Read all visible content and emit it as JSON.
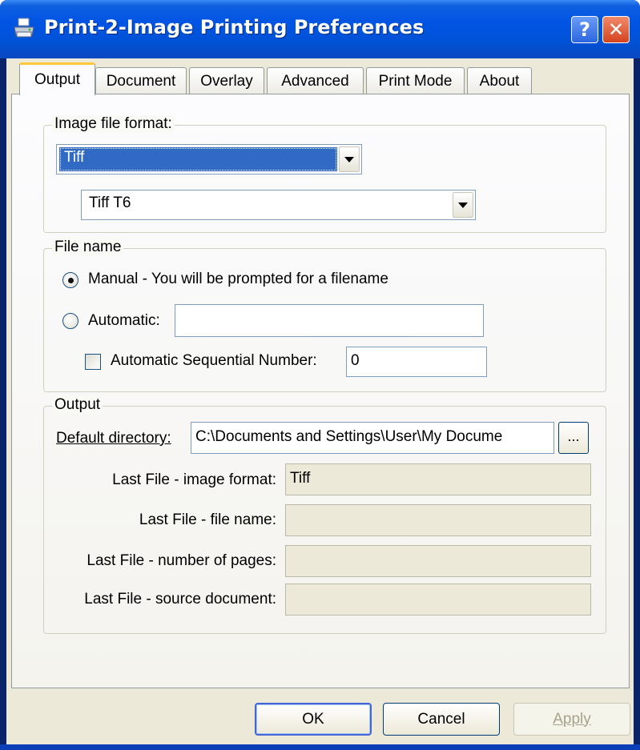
{
  "window": {
    "title": "Print-2-Image Printing Preferences",
    "help_label": "?",
    "close_label": "✕"
  },
  "tabs": [
    {
      "label": "Output",
      "active": true
    },
    {
      "label": "Document",
      "active": false
    },
    {
      "label": "Overlay",
      "active": false
    },
    {
      "label": "Advanced",
      "active": false
    },
    {
      "label": "Print Mode",
      "active": false
    },
    {
      "label": "About",
      "active": false
    }
  ],
  "image_format": {
    "group_label": "Image file format:",
    "format_value": "Tiff",
    "subformat_value": "Tiff T6"
  },
  "file_name": {
    "group_label": "File name",
    "manual_label": "Manual - You will be prompted for a filename",
    "manual_selected": true,
    "automatic_label": "Automatic:",
    "automatic_selected": false,
    "automatic_value": "",
    "sequential_label": "Automatic Sequential Number:",
    "sequential_checked": false,
    "sequential_value": "0"
  },
  "output": {
    "group_label": "Output",
    "default_dir_label": "Default directory:",
    "default_dir_value": "C:\\Documents and Settings\\User\\My Docume",
    "browse_label": "...",
    "last_format_label": "Last File - image format:",
    "last_format_value": "Tiff",
    "last_name_label": "Last File - file name:",
    "last_name_value": "",
    "last_pages_label": "Last File - number of pages:",
    "last_pages_value": "",
    "last_source_label": "Last File - source document:",
    "last_source_value": ""
  },
  "buttons": {
    "ok": "OK",
    "cancel": "Cancel",
    "apply": "Apply"
  },
  "colors": {
    "titlebar": "#0054e3",
    "dialog_bg": "#ece9d8",
    "selection": "#316ac5",
    "active_tab_accent": "#ffc83c"
  }
}
